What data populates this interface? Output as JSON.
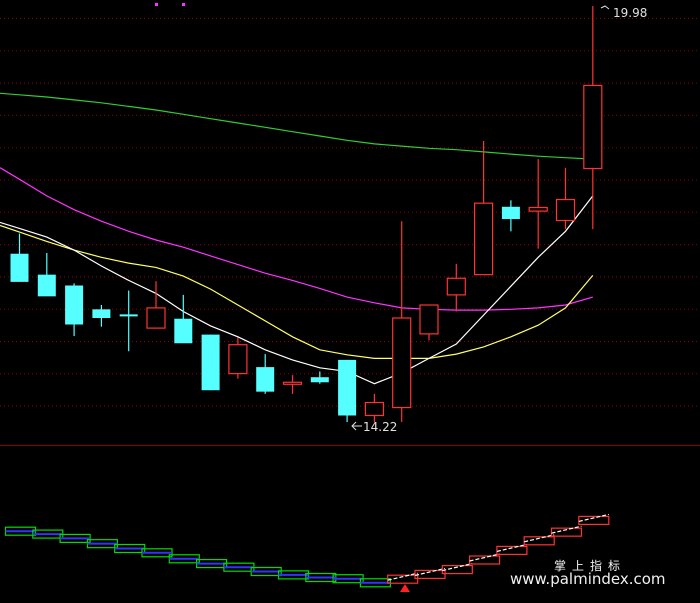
{
  "chart_data": {
    "type": "candlestick",
    "ylim": [
      13.5,
      20.2
    ],
    "grid": true,
    "colors": {
      "up": "#ff3333",
      "down": "#55ffff",
      "ma5": "#ffffff",
      "ma10": "#ffff66",
      "ma20": "#ff33ff",
      "ma60": "#33cc33",
      "background": "#000000",
      "grid": "#8b0000"
    },
    "candles": [
      {
        "o": 16.55,
        "h": 16.83,
        "l": 16.33,
        "c": 16.16
      },
      {
        "o": 16.26,
        "h": 16.56,
        "l": 16.06,
        "c": 15.96
      },
      {
        "o": 16.11,
        "h": 16.14,
        "l": 15.41,
        "c": 15.57
      },
      {
        "o": 15.78,
        "h": 15.84,
        "l": 15.54,
        "c": 15.66
      },
      {
        "o": 15.71,
        "h": 16.04,
        "l": 15.2,
        "c": 15.7
      },
      {
        "o": 15.52,
        "h": 16.17,
        "l": 15.52,
        "c": 15.8
      },
      {
        "o": 15.65,
        "h": 15.98,
        "l": 15.34,
        "c": 15.31
      },
      {
        "o": 15.43,
        "h": 15.43,
        "l": 14.66,
        "c": 14.66
      },
      {
        "o": 14.89,
        "h": 15.39,
        "l": 14.82,
        "c": 15.29
      },
      {
        "o": 14.98,
        "h": 15.16,
        "l": 14.61,
        "c": 14.64
      },
      {
        "o": 14.75,
        "h": 14.87,
        "l": 14.61,
        "c": 14.77
      },
      {
        "o": 14.84,
        "h": 14.92,
        "l": 14.75,
        "c": 14.77
      },
      {
        "o": 15.08,
        "h": 15.08,
        "l": 14.22,
        "c": 14.31
      },
      {
        "o": 14.31,
        "h": 14.61,
        "l": 14.22,
        "c": 14.49
      },
      {
        "o": 14.42,
        "h": 17.0,
        "l": 14.22,
        "c": 15.66
      },
      {
        "o": 15.44,
        "h": 15.84,
        "l": 15.35,
        "c": 15.84
      },
      {
        "o": 15.98,
        "h": 16.41,
        "l": 15.75,
        "c": 16.21
      },
      {
        "o": 16.26,
        "h": 18.11,
        "l": 16.26,
        "c": 17.25
      },
      {
        "o": 17.2,
        "h": 17.29,
        "l": 16.86,
        "c": 17.03
      },
      {
        "o": 17.14,
        "h": 17.86,
        "l": 16.62,
        "c": 17.19
      },
      {
        "o": 17.01,
        "h": 17.74,
        "l": 16.89,
        "c": 17.3
      },
      {
        "o": 17.73,
        "h": 19.98,
        "l": 16.89,
        "c": 18.88
      }
    ],
    "ma5": [
      16.9,
      16.78,
      16.6,
      16.38,
      16.18,
      16.0,
      15.75,
      15.55,
      15.4,
      15.22,
      15.08,
      14.97,
      14.92,
      14.75,
      14.9,
      15.1,
      15.3,
      15.7,
      16.1,
      16.5,
      16.86,
      17.35
    ],
    "ma10": [
      16.85,
      16.72,
      16.6,
      16.5,
      16.42,
      16.36,
      16.24,
      16.06,
      15.84,
      15.62,
      15.4,
      15.22,
      15.15,
      15.1,
      15.1,
      15.1,
      15.16,
      15.26,
      15.4,
      15.56,
      15.8,
      16.25
    ],
    "ma20": [
      17.58,
      17.35,
      17.16,
      17.0,
      16.86,
      16.74,
      16.64,
      16.52,
      16.4,
      16.28,
      16.18,
      16.07,
      15.95,
      15.87,
      15.8,
      15.78,
      15.77,
      15.77,
      15.78,
      15.8,
      15.84,
      15.95
    ],
    "ma60": [
      18.75,
      18.72,
      18.68,
      18.64,
      18.59,
      18.54,
      18.48,
      18.42,
      18.36,
      18.3,
      18.24,
      18.18,
      18.12,
      18.07,
      18.04,
      18.01,
      17.99,
      17.96,
      17.93,
      17.9,
      17.88,
      17.86
    ],
    "annotations": [
      {
        "text": "14.22",
        "candle": 13,
        "price": 14.22
      },
      {
        "text": "19.98",
        "candle": 21,
        "price": 19.98
      }
    ]
  },
  "watermark": {
    "title": "掌上指标",
    "url": "www.palmindex.com"
  }
}
